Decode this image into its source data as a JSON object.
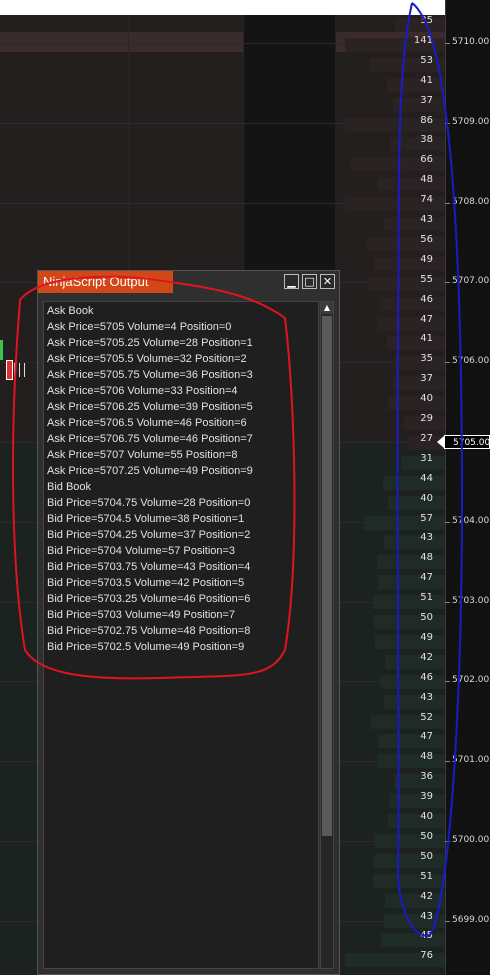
{
  "window": {
    "title": "NinjaScript Output",
    "minimize_label": "▁",
    "maximize_label": "□",
    "close_label": "✕",
    "scroll_up_label": "▲"
  },
  "output_lines": [
    "Ask Book",
    "Ask Price=5705 Volume=4 Position=0",
    "Ask Price=5705.25 Volume=28 Position=1",
    "Ask Price=5705.5 Volume=32 Position=2",
    "Ask Price=5705.75 Volume=36 Position=3",
    "Ask Price=5706 Volume=33 Position=4",
    "Ask Price=5706.25 Volume=39 Position=5",
    "Ask Price=5706.5 Volume=46 Position=6",
    "Ask Price=5706.75 Volume=46 Position=7",
    "Ask Price=5707 Volume=55 Position=8",
    "Ask Price=5707.25 Volume=49 Position=9",
    "Bid Book",
    "Bid Price=5704.75 Volume=28 Position=0",
    "Bid Price=5704.5 Volume=38 Position=1",
    "Bid Price=5704.25 Volume=37 Position=2",
    "Bid Price=5704 Volume=57 Position=3",
    "Bid Price=5703.75 Volume=43 Position=4",
    "Bid Price=5703.5 Volume=42 Position=5",
    "Bid Price=5703.25 Volume=46 Position=6",
    "Bid Price=5703 Volume=49 Position=7",
    "Bid Price=5702.75 Volume=48 Position=8",
    "Bid Price=5702.5 Volume=49 Position=9"
  ],
  "volume_ladder": [
    "35",
    "141",
    "53",
    "41",
    "37",
    "86",
    "38",
    "66",
    "48",
    "74",
    "43",
    "56",
    "49",
    "55",
    "46",
    "47",
    "41",
    "35",
    "37",
    "40",
    "29",
    "27",
    "31",
    "44",
    "40",
    "57",
    "43",
    "48",
    "47",
    "51",
    "50",
    "49",
    "42",
    "46",
    "43",
    "52",
    "47",
    "48",
    "36",
    "39",
    "40",
    "50",
    "50",
    "51",
    "42",
    "43",
    "45",
    "76"
  ],
  "price_axis": [
    "5710.00",
    "5709.00",
    "5708.00",
    "5707.00",
    "5706.00",
    "5705.00",
    "5704.00",
    "5703.00",
    "5702.00",
    "5701.00",
    "5700.00",
    "5699.00"
  ],
  "current_price": "5705.00",
  "current_price_index": 5,
  "colors": {
    "title_bar": "#d24718",
    "annotation_red": "#e0141e",
    "annotation_blue": "#1a1ac8",
    "ask_shade": "#3a2c2c",
    "bid_shade": "#1e2a26"
  }
}
